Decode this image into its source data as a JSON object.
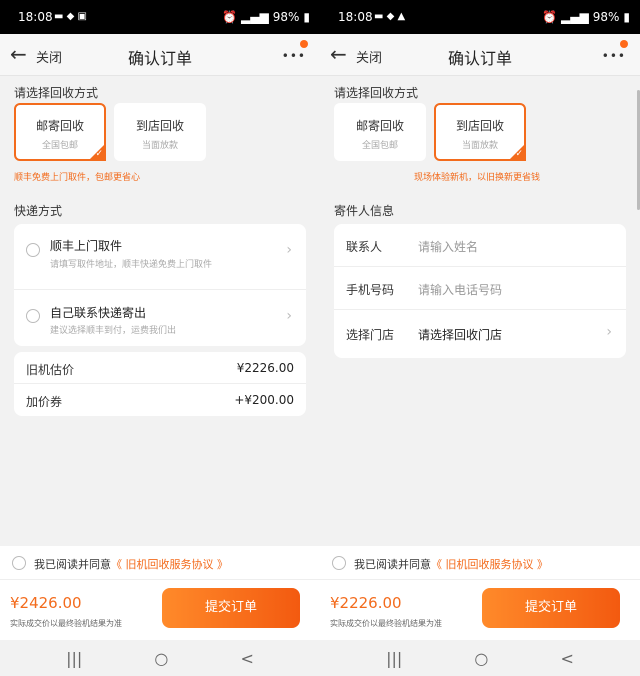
{
  "status": {
    "time": "18:08",
    "battery": "98%"
  },
  "appbar": {
    "close": "关闭",
    "title": "确认订单",
    "more": "•••"
  },
  "left": {
    "method_title": "请选择回收方式",
    "methods": [
      {
        "title": "邮寄回收",
        "sub": "全国包邮"
      },
      {
        "title": "到店回收",
        "sub": "当面放款"
      }
    ],
    "hint": "顺丰免费上门取件，包邮更省心",
    "delivery_title": "快递方式",
    "delivery": [
      {
        "title": "顺丰上门取件",
        "sub": "请填写取件地址，顺丰快递免费上门取件"
      },
      {
        "title": "自己联系快递寄出",
        "sub": "建议选择顺丰到付，运费我们出"
      }
    ],
    "prices": [
      {
        "label": "旧机估价",
        "value": "¥2226.00"
      },
      {
        "label": "加价券",
        "value": "+¥200.00"
      }
    ],
    "agree_prefix": "我已阅读并同意",
    "agree_link": "《 旧机回收服务协议 》",
    "total": "¥2426.00",
    "total_note": "实际成交价以最终验机结果为准",
    "submit": "提交订单"
  },
  "right": {
    "method_title": "请选择回收方式",
    "methods": [
      {
        "title": "邮寄回收",
        "sub": "全国包邮"
      },
      {
        "title": "到店回收",
        "sub": "当面放款"
      }
    ],
    "hint": "现场体验新机，以旧换新更省钱",
    "sender_title": "寄件人信息",
    "fields": [
      {
        "label": "联系人",
        "placeholder": "请输入姓名"
      },
      {
        "label": "手机号码",
        "placeholder": "请输入电话号码"
      },
      {
        "label": "选择门店",
        "placeholder": "请选择回收门店"
      }
    ],
    "agree_prefix": "我已阅读并同意",
    "agree_link": "《 旧机回收服务协议 》",
    "total": "¥2226.00",
    "total_note": "实际成交价以最终验机结果为准",
    "submit": "提交订单"
  },
  "nav": {
    "recent": "|||",
    "home": "○",
    "back": "<"
  },
  "colors": {
    "accent": "#f36b1c"
  }
}
